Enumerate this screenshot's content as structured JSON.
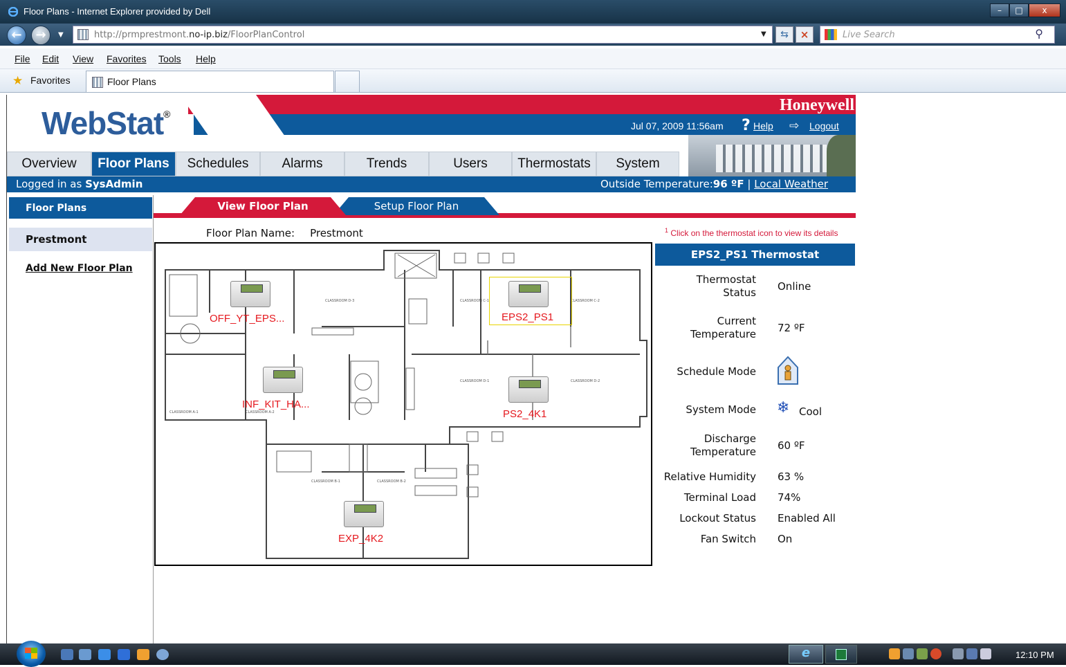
{
  "browser": {
    "window_title": "Floor Plans - Internet Explorer provided by Dell",
    "url_prefix": "http://prmprestmont.",
    "url_domain": "no-ip.biz",
    "url_path": "/FloorPlanControl",
    "search_placeholder": "Live Search",
    "menu": [
      "File",
      "Edit",
      "View",
      "Favorites",
      "Tools",
      "Help"
    ],
    "favorites_label": "Favorites",
    "tab_title": "Floor Plans"
  },
  "header": {
    "logo": "WebStat",
    "logo_mark": "®",
    "brand": "Honeywell",
    "datetime": "Jul 07, 2009 11:56am",
    "help_label": "Help",
    "logout_label": "Logout"
  },
  "main_tabs": [
    "Overview",
    "Floor Plans",
    "Schedules",
    "Alarms",
    "Trends",
    "Users",
    "Thermostats",
    "System"
  ],
  "active_tab": "Floor Plans",
  "status": {
    "logged_in_prefix": "Logged in as ",
    "user": "SysAdmin",
    "outside_temp_label": "Outside Temperature:",
    "outside_temp_value": "96 ºF",
    "separator": " | ",
    "local_weather": "Local Weather"
  },
  "left_nav": {
    "heading": "Floor Plans",
    "item": "Prestmont",
    "add_link": "Add New Floor Plan"
  },
  "sub_tabs": {
    "view": "View Floor Plan",
    "setup": "Setup Floor Plan"
  },
  "floor_plan": {
    "name_label": "Floor Plan Name:",
    "name_value": "Prestmont",
    "hint_mark": "1",
    "hint": "Click on the thermostat icon to view its details",
    "thermostats": [
      "OFF_YT_EPS...",
      "EPS2_PS1",
      "INF_KIT_HA...",
      "PS2_4K1",
      "EXP_4K2"
    ],
    "selected": "EPS2_PS1"
  },
  "details": {
    "title": "EPS2_PS1 Thermostat",
    "rows": {
      "thermostat_status": {
        "k1": "Thermostat",
        "k2": "Status",
        "v": "Online"
      },
      "current_temp": {
        "k1": "Current",
        "k2": "Temperature",
        "v": "72 ºF"
      },
      "schedule_mode": {
        "k": "Schedule Mode"
      },
      "system_mode": {
        "k": "System Mode",
        "v": "Cool"
      },
      "discharge_temp": {
        "k1": "Discharge",
        "k2": "Temperature",
        "v": "60 ºF"
      },
      "humidity": {
        "k": "Relative Humidity",
        "v": "63 %"
      },
      "terminal_load": {
        "k": "Terminal Load",
        "v": "74%"
      },
      "lockout_status": {
        "k": "Lockout Status",
        "v": "Enabled All"
      },
      "fan_switch": {
        "k": "Fan Switch",
        "v": "On"
      }
    }
  },
  "taskbar": {
    "clock": "12:10 PM"
  },
  "colors": {
    "honeywell_red": "#d4193a",
    "honeywell_blue": "#0d5a9c",
    "thermostat_label": "#e5181e"
  },
  "icons": [
    "ie-logo-icon",
    "back-arrow-icon",
    "forward-arrow-icon",
    "refresh-icon",
    "stop-icon",
    "search-icon",
    "favorites-star-icon",
    "help-icon",
    "logout-icon",
    "schedule-home-icon",
    "snowflake-icon",
    "windows-start-icon"
  ]
}
